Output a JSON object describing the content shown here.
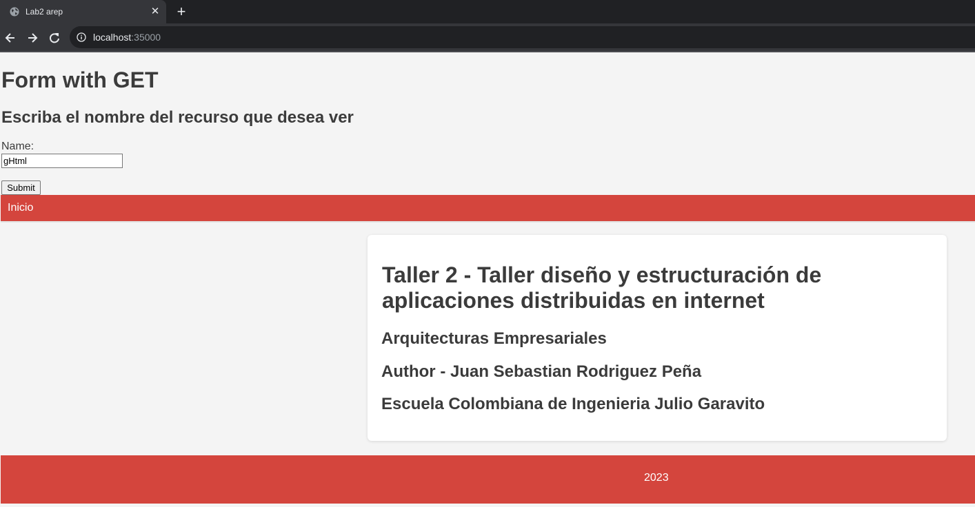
{
  "browser": {
    "tab_title": "Lab2 arep",
    "url_host": "localhost",
    "url_port": ":35000",
    "icons": [
      "globe-icon",
      "close-icon",
      "plus-icon",
      "back-arrow-icon",
      "forward-arrow-icon",
      "reload-icon",
      "info-icon"
    ],
    "colors": {
      "tabbar_bg": "#202124",
      "toolbar_bg": "#35363a"
    }
  },
  "form": {
    "title": "Form with GET",
    "subtitle": "Escriba el nombre del recurso que desea ver",
    "name_label": "Name:",
    "name_value": "gHtml",
    "submit_label": "Submit"
  },
  "nav": {
    "link_label": "Inicio"
  },
  "card": {
    "title": "Taller 2 - Taller diseño y estructuración de aplicaciones distribuidas en internet",
    "lines": [
      "Arquitecturas Empresariales",
      "Author - Juan Sebastian Rodriguez Peña",
      "Escuela Colombiana de Ingenieria Julio Garavito"
    ]
  },
  "footer": {
    "text": "2023"
  },
  "colors": {
    "accent": "#d4453d",
    "page_bg": "#f4f4f4",
    "text": "#3b3b3b",
    "card_bg": "#ffffff"
  }
}
